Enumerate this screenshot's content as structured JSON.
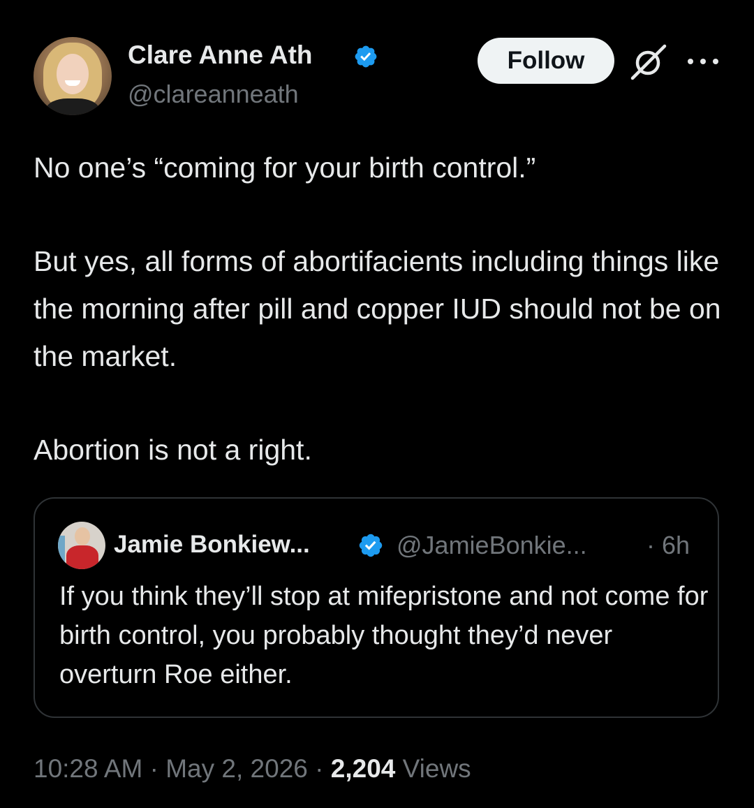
{
  "author": {
    "display_name": "Clare Anne Ath",
    "handle": "@clareanneath",
    "verified": true
  },
  "actions": {
    "follow_label": "Follow",
    "grok_icon": "grok-icon",
    "more_icon": "more-options-icon"
  },
  "tweet": {
    "paragraphs": [
      "No one’s “coming for your birth control.”",
      "But yes, all forms of abortifacients including things like the morning after pill and copper IUD should not be on the market.",
      "Abortion is not a right."
    ]
  },
  "quoted_tweet": {
    "display_name": "Jamie Bonkiew...",
    "handle": "@JamieBonkie...",
    "separator": "·",
    "time": "6h",
    "verified": true,
    "text": "If you think they’ll stop at mifepristone and not come for birth control, you probably thought they’d never overturn Roe either."
  },
  "meta": {
    "time": "10:28 AM",
    "sep1": " · ",
    "date": "May 2, 2026",
    "sep2": " · ",
    "views_count": "2,204",
    "views_label": " Views"
  },
  "colors": {
    "background": "#000000",
    "text_primary": "#e7e9ea",
    "text_secondary": "#71767b",
    "verified_blue": "#1d9bf0",
    "border": "#2f3336",
    "follow_bg": "#eff3f4"
  }
}
